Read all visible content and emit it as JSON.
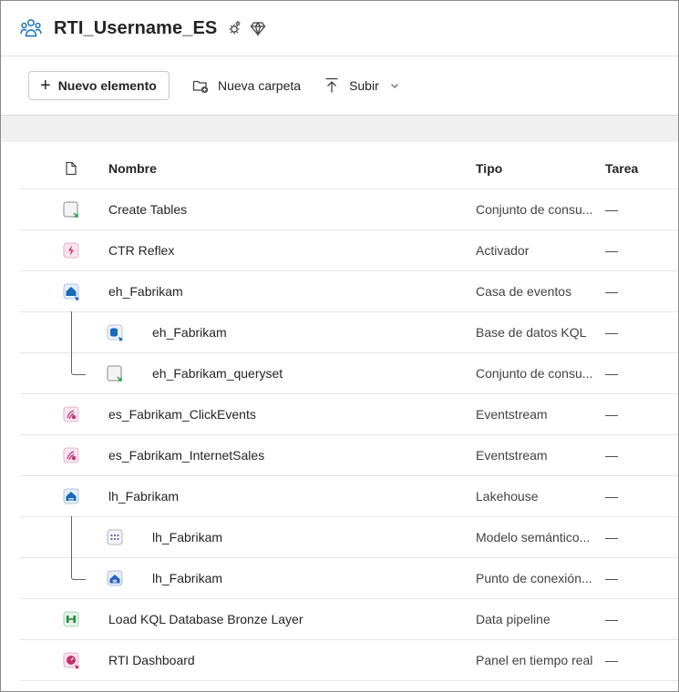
{
  "workspace": {
    "title": "RTI_Username_ES",
    "icon": "workspace-people-icon",
    "badges": [
      "workspace-settings-icon",
      "premium-diamond-icon"
    ]
  },
  "toolbar": {
    "new_item_label": "Nuevo elemento",
    "new_folder_label": "Nueva carpeta",
    "upload_label": "Subir"
  },
  "table": {
    "headers": {
      "name": "Nombre",
      "type": "Tipo",
      "task": "Tarea"
    },
    "rows": [
      {
        "name": "Create Tables",
        "type": "Conjunto de consu...",
        "task": "—",
        "icon": "kql-queryset-icon",
        "child": false
      },
      {
        "name": "CTR Reflex",
        "type": "Activador",
        "task": "—",
        "icon": "activator-icon",
        "child": false
      },
      {
        "name": "eh_Fabrikam",
        "type": "Casa de eventos",
        "task": "—",
        "icon": "eventhouse-icon",
        "child": false
      },
      {
        "name": "eh_Fabrikam",
        "type": "Base de datos KQL",
        "task": "—",
        "icon": "kql-database-icon",
        "child": true
      },
      {
        "name": "eh_Fabrikam_queryset",
        "type": "Conjunto de consu...",
        "task": "—",
        "icon": "kql-queryset-icon",
        "child": true
      },
      {
        "name": "es_Fabrikam_ClickEvents",
        "type": "Eventstream",
        "task": "—",
        "icon": "eventstream-icon",
        "child": false
      },
      {
        "name": "es_Fabrikam_InternetSales",
        "type": "Eventstream",
        "task": "—",
        "icon": "eventstream-icon",
        "child": false
      },
      {
        "name": "lh_Fabrikam",
        "type": "Lakehouse",
        "task": "—",
        "icon": "lakehouse-icon",
        "child": false
      },
      {
        "name": "lh_Fabrikam",
        "type": "Modelo semántico...",
        "task": "—",
        "icon": "semantic-model-icon",
        "child": true
      },
      {
        "name": "lh_Fabrikam",
        "type": "Punto de conexión...",
        "task": "—",
        "icon": "sql-endpoint-icon",
        "child": true
      },
      {
        "name": "Load KQL Database Bronze Layer",
        "type": "Data pipeline",
        "task": "—",
        "icon": "data-pipeline-icon",
        "child": false
      },
      {
        "name": "RTI Dashboard",
        "type": "Panel en tiempo real",
        "task": "—",
        "icon": "realtime-dashboard-icon",
        "child": false
      }
    ]
  },
  "colors": {
    "accent": "#0f6cbd",
    "eventstream": "#c03a7a",
    "pipeline": "#1e8a3c",
    "activator": "#c4306b"
  }
}
